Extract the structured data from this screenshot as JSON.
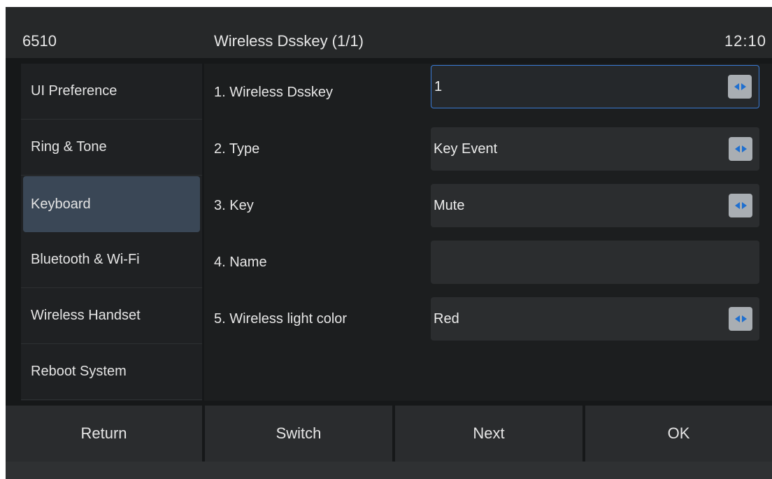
{
  "header": {
    "model": "6510",
    "title": "Wireless Dsskey (1/1)",
    "time": "12:10"
  },
  "sidebar": {
    "items": [
      {
        "label": "UI Preference"
      },
      {
        "label": "Ring & Tone"
      },
      {
        "label": "Keyboard"
      },
      {
        "label": "Bluetooth & Wi-Fi"
      },
      {
        "label": "Wireless Handset"
      },
      {
        "label": "Reboot System"
      }
    ],
    "active_index": 2
  },
  "settings": [
    {
      "label": "1. Wireless Dsskey",
      "value": "1"
    },
    {
      "label": "2. Type",
      "value": "Key Event"
    },
    {
      "label": "3. Key",
      "value": "Mute"
    },
    {
      "label": "4. Name",
      "value": ""
    },
    {
      "label": "5. Wireless light color",
      "value": "Red"
    }
  ],
  "softkeys": {
    "return": "Return",
    "switch": "Switch",
    "next": "Next",
    "ok": "OK"
  },
  "colors": {
    "focus_border": "#3a7bd5",
    "arrow_accent": "#1e6fd0",
    "active_item": "#3a4756"
  }
}
